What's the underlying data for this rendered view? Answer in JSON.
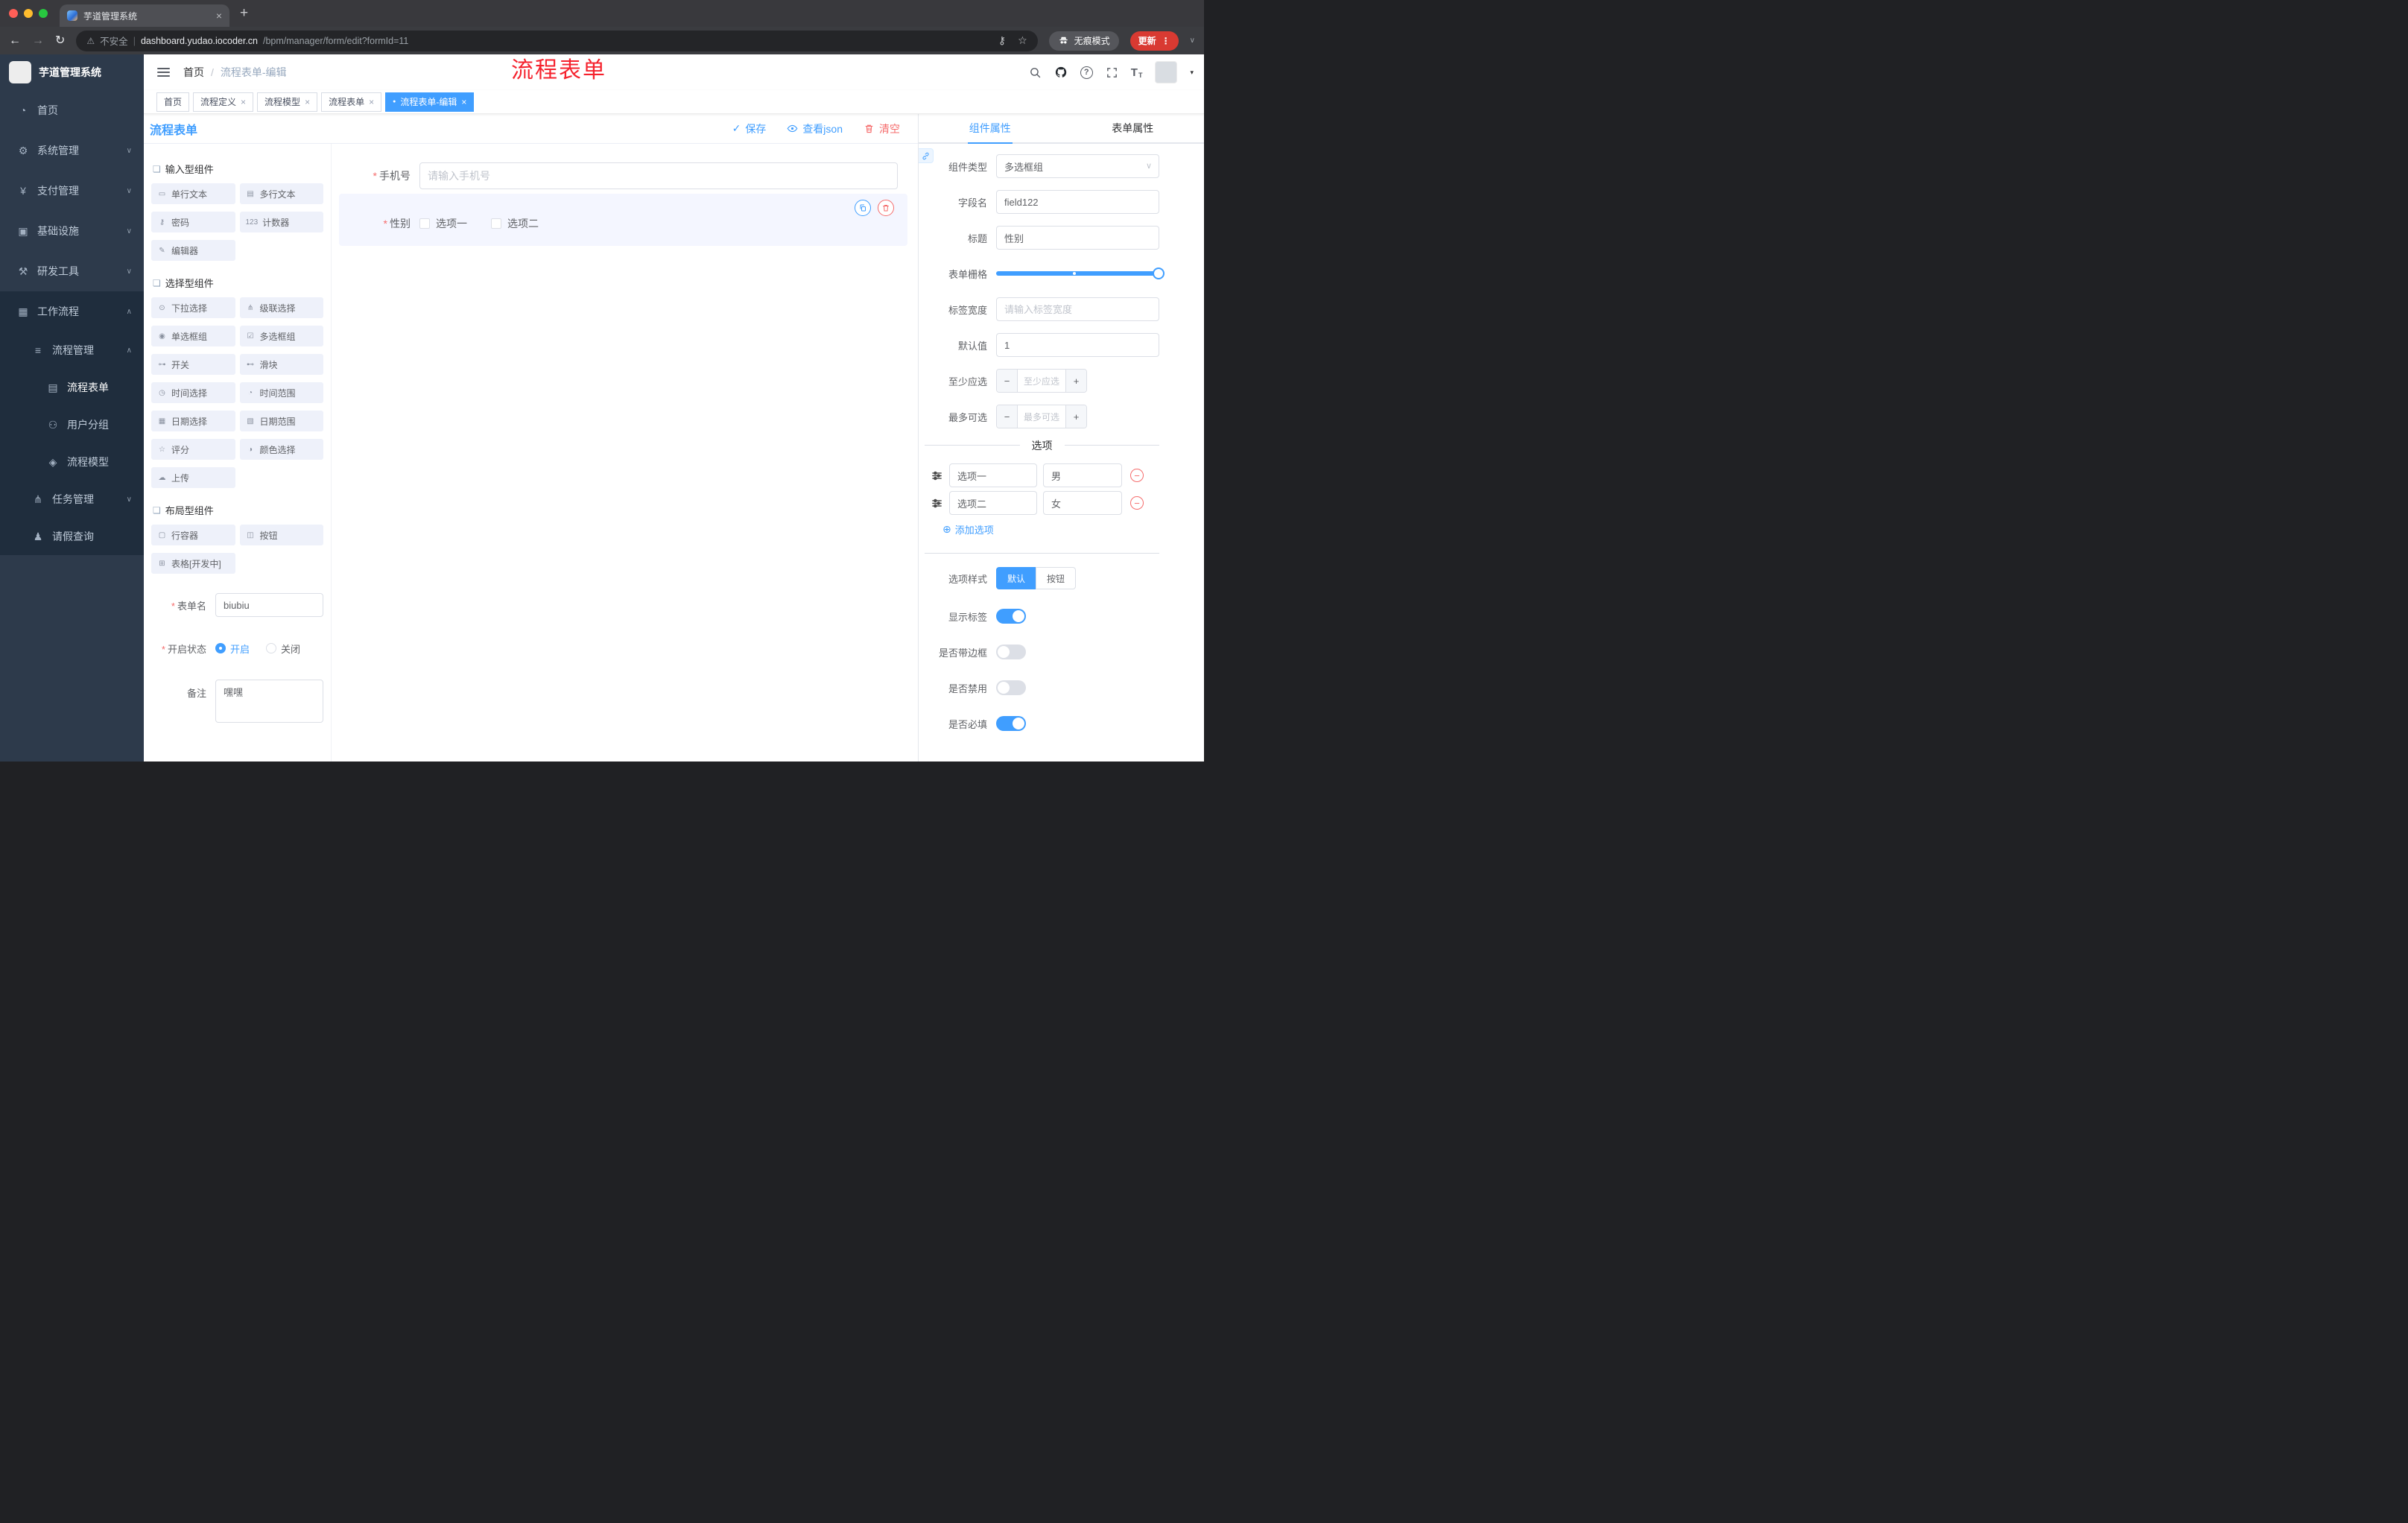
{
  "browser": {
    "tab_title": "芋道管理系统",
    "security_label": "不安全",
    "url_domain": "dashboard.yudao.iocoder.cn",
    "url_path": "/bpm/manager/form/edit?formId=11",
    "incognito_label": "无痕模式",
    "update_label": "更新"
  },
  "icons": {
    "close": "×",
    "dot": "●",
    "back": "←",
    "forward": "→",
    "reload": "↻",
    "warning": "⚠",
    "star": "☆",
    "key": "⚷",
    "dots": "⋮",
    "caret": "∨",
    "caret_small": "▾",
    "check": "✓",
    "question": "?",
    "font_size": "T",
    "plus_circle": "⊕",
    "minus": "−",
    "plus": "+",
    "divider": "|",
    "asterisk": "*",
    "group_icon": "❏"
  },
  "sidebar": {
    "logo_title": "芋道管理系统",
    "menu": [
      {
        "icon": "◔",
        "label": "首页",
        "indent": 0,
        "chevron": "",
        "dark": false,
        "active": false
      },
      {
        "icon": "⚙",
        "label": "系统管理",
        "indent": 0,
        "chevron": "∨",
        "dark": false,
        "active": false
      },
      {
        "icon": "¥",
        "label": "支付管理",
        "indent": 0,
        "chevron": "∨",
        "dark": false,
        "active": false
      },
      {
        "icon": "▣",
        "label": "基础设施",
        "indent": 0,
        "chevron": "∨",
        "dark": false,
        "active": false
      },
      {
        "icon": "⚒",
        "label": "研发工具",
        "indent": 0,
        "chevron": "∨",
        "dark": false,
        "active": false
      },
      {
        "icon": "▦",
        "label": "工作流程",
        "indent": 0,
        "chevron": "∧",
        "dark": true,
        "active": false
      },
      {
        "icon": "≡",
        "label": "流程管理",
        "indent": 1,
        "chevron": "∧",
        "dark": true,
        "active": false
      },
      {
        "icon": "▤",
        "label": "流程表单",
        "indent": 2,
        "chevron": "",
        "dark": true,
        "active": true
      },
      {
        "icon": "⚇",
        "label": "用户分组",
        "indent": 2,
        "chevron": "",
        "dark": true,
        "active": false
      },
      {
        "icon": "◈",
        "label": "流程模型",
        "indent": 2,
        "chevron": "",
        "dark": true,
        "active": false
      },
      {
        "icon": "⋔",
        "label": "任务管理",
        "indent": 1,
        "chevron": "∨",
        "dark": true,
        "active": false
      },
      {
        "icon": "♟",
        "label": "请假查询",
        "indent": 1,
        "chevron": "",
        "dark": true,
        "active": false
      }
    ]
  },
  "header": {
    "breadcrumb_home": "首页",
    "breadcrumb_sep": "/",
    "breadcrumb_current": "流程表单-编辑",
    "overlay_title": "流程表单"
  },
  "tags": [
    {
      "label": "首页",
      "closable": false,
      "active": false
    },
    {
      "label": "流程定义",
      "closable": true,
      "active": false
    },
    {
      "label": "流程模型",
      "closable": true,
      "active": false
    },
    {
      "label": "流程表单",
      "closable": true,
      "active": false
    },
    {
      "label": "流程表单-编辑",
      "closable": true,
      "active": true
    }
  ],
  "designer": {
    "title": "流程表单",
    "save_label": "保存",
    "view_json_label": "查看json",
    "clear_label": "清空"
  },
  "palette": {
    "group_input_title": "输入型组件",
    "group_input": [
      {
        "icon": "▭",
        "label": "单行文本"
      },
      {
        "icon": "▤",
        "label": "多行文本"
      },
      {
        "icon": "⚷",
        "label": "密码"
      },
      {
        "icon": "123",
        "label": "计数器"
      },
      {
        "icon": "✎",
        "label": "编辑器"
      }
    ],
    "group_select_title": "选择型组件",
    "group_select": [
      {
        "icon": "⊙",
        "label": "下拉选择"
      },
      {
        "icon": "⋔",
        "label": "级联选择"
      },
      {
        "icon": "◉",
        "label": "单选框组"
      },
      {
        "icon": "☑",
        "label": "多选框组"
      },
      {
        "icon": "⊶",
        "label": "开关"
      },
      {
        "icon": "⊷",
        "label": "滑块"
      },
      {
        "icon": "◷",
        "label": "时间选择"
      },
      {
        "icon": "◔",
        "label": "时间范围"
      },
      {
        "icon": "▦",
        "label": "日期选择"
      },
      {
        "icon": "▧",
        "label": "日期范围"
      },
      {
        "icon": "☆",
        "label": "评分"
      },
      {
        "icon": "◑",
        "label": "颜色选择"
      },
      {
        "icon": "☁",
        "label": "上传"
      }
    ],
    "group_layout_title": "布局型组件",
    "group_layout": [
      {
        "icon": "▢",
        "label": "行容器"
      },
      {
        "icon": "◫",
        "label": "按钮"
      },
      {
        "icon": "⊞",
        "label": "表格[开发中]"
      }
    ]
  },
  "meta_form": {
    "name_label": "表单名",
    "name_value": "biubiu",
    "status_label": "开启状态",
    "status_on": "开启",
    "status_off": "关闭",
    "remark_label": "备注",
    "remark_value": "嘿嘿"
  },
  "canvas": {
    "phone_label": "手机号",
    "phone_placeholder": "请输入手机号",
    "gender_label": "性别",
    "gender_options": [
      "选项一",
      "选项二"
    ]
  },
  "inspector": {
    "tab_component": "组件属性",
    "tab_form": "表单属性",
    "component_type_label": "组件类型",
    "component_type_value": "多选框组",
    "field_name_label": "字段名",
    "field_name_value": "field122",
    "title_label": "标题",
    "title_value": "性别",
    "grid_label": "表单栅格",
    "label_width_label": "标签宽度",
    "label_width_placeholder": "请输入标签宽度",
    "default_label": "默认值",
    "default_value": "1",
    "min_label": "至少应选",
    "min_placeholder": "至少应选",
    "max_label": "最多可选",
    "max_placeholder": "最多可选",
    "options_divider": "选项",
    "options": [
      {
        "name": "选项一",
        "value": "男"
      },
      {
        "name": "选项二",
        "value": "女"
      }
    ],
    "add_option_label": "添加选项",
    "style_label": "选项样式",
    "style_default": "默认",
    "style_button": "按钮",
    "switches": [
      {
        "label": "显示标签",
        "on": true
      },
      {
        "label": "是否带边框",
        "on": false
      },
      {
        "label": "是否禁用",
        "on": false
      },
      {
        "label": "是否必填",
        "on": true
      }
    ]
  }
}
